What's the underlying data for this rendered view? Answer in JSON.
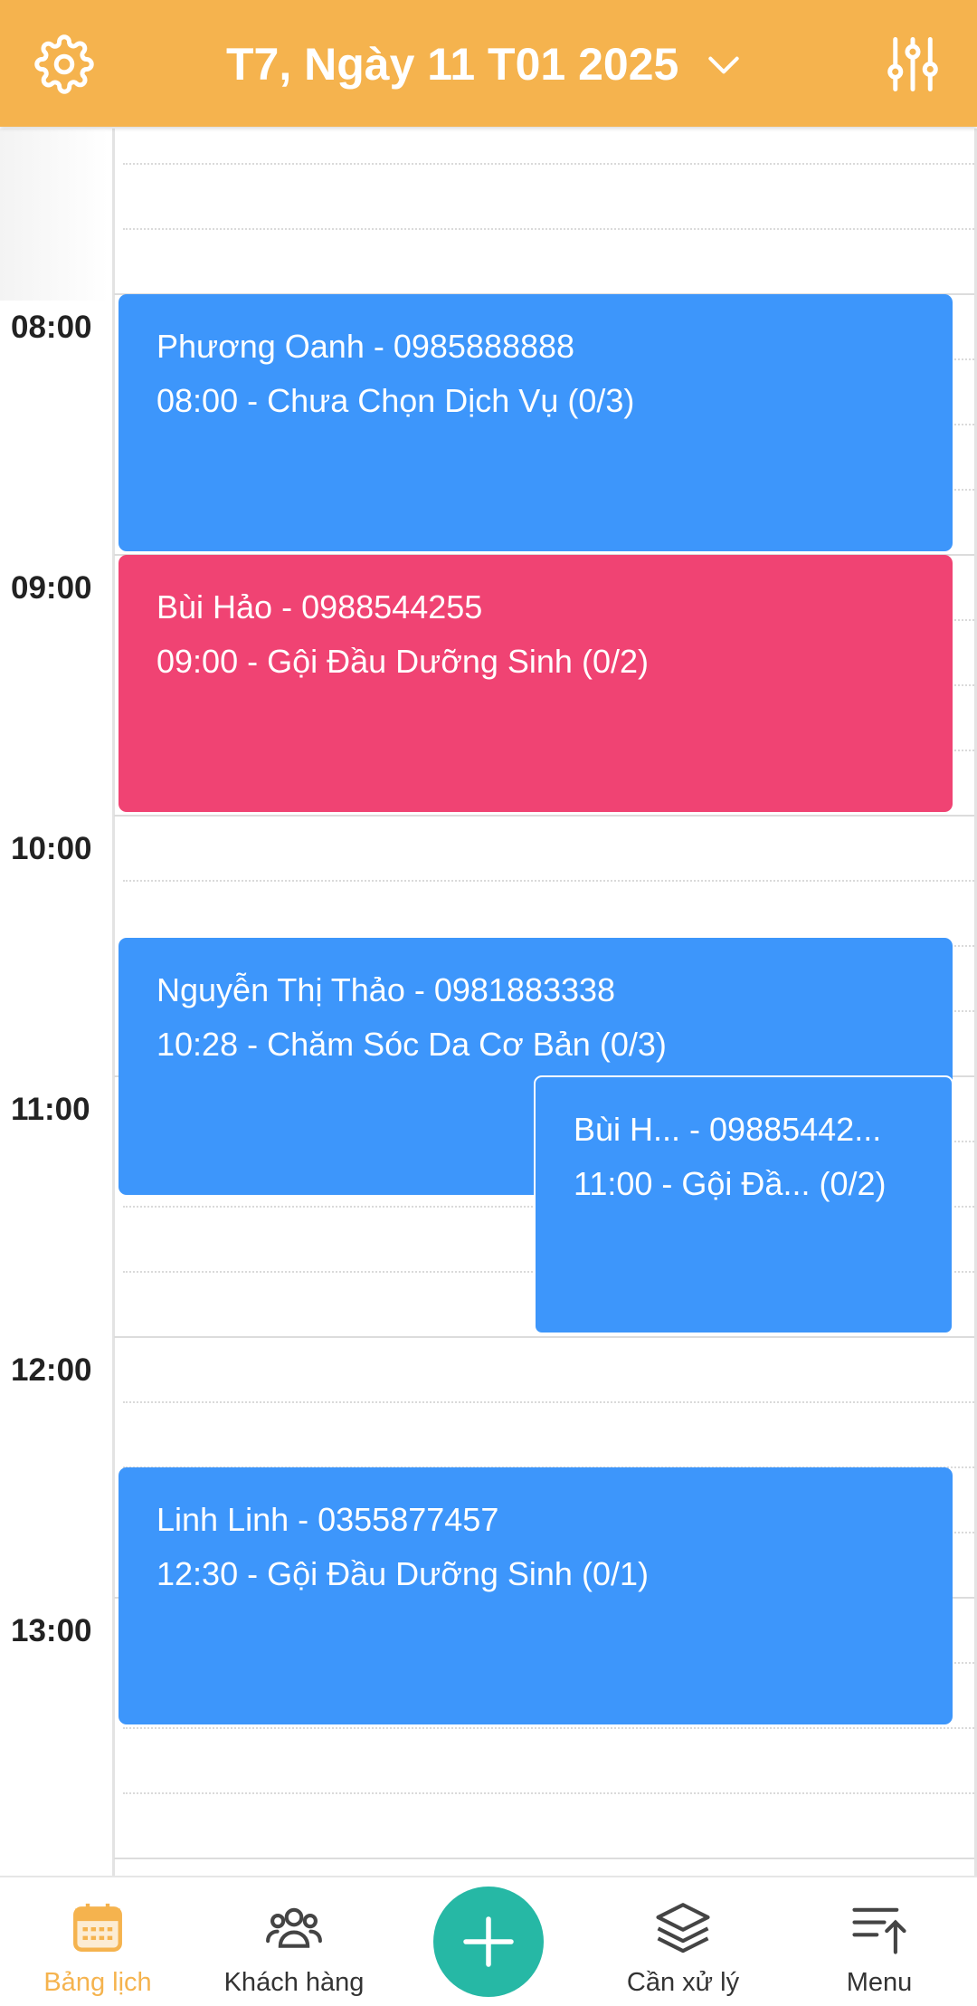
{
  "header": {
    "title": "T7, Ngày 11 T01 2025",
    "bg_color": "#f5b34e",
    "icons": [
      "gear-icon",
      "chevron-down-icon",
      "sliders-icon"
    ]
  },
  "timeline": {
    "hours": [
      "08:00",
      "09:00",
      "10:00",
      "11:00",
      "12:00",
      "13:00"
    ]
  },
  "events": [
    {
      "line1": "Phương Oanh - 0985888888",
      "line2": "08:00 - Chưa Chọn Dịch Vụ (0/3)",
      "color": "#3d96fb"
    },
    {
      "line1": "Bùi Hảo - 0988544255",
      "line2": "09:00 - Gội Đầu Dưỡng Sinh (0/2)",
      "color": "#f04373"
    },
    {
      "line1": "Nguyễn Thị Thảo - 0981883338",
      "line2": "10:28 - Chăm Sóc Da Cơ Bản (0/3)",
      "color": "#3d96fb"
    },
    {
      "line1": "Bùi H...   - 09885442...",
      "line2": "11:00 - Gội Đầ...   (0/2)",
      "color": "#3d96fb"
    },
    {
      "line1": "Linh Linh - 0355877457",
      "line2": "12:30 - Gội Đầu Dưỡng Sinh (0/1)",
      "color": "#3d96fb"
    }
  ],
  "bottom_nav": {
    "items": [
      {
        "label": "Bảng lịch",
        "icon": "calendar-icon",
        "active": true,
        "color": "#f5b34e"
      },
      {
        "label": "Khách hàng",
        "icon": "users-icon",
        "active": false
      },
      {
        "label": "",
        "icon": "plus-icon",
        "active": false,
        "color": "#26b8a5"
      },
      {
        "label": "Cần xử lý",
        "icon": "layers-icon",
        "active": false
      },
      {
        "label": "Menu",
        "icon": "menu-sort-icon",
        "active": false
      }
    ]
  }
}
